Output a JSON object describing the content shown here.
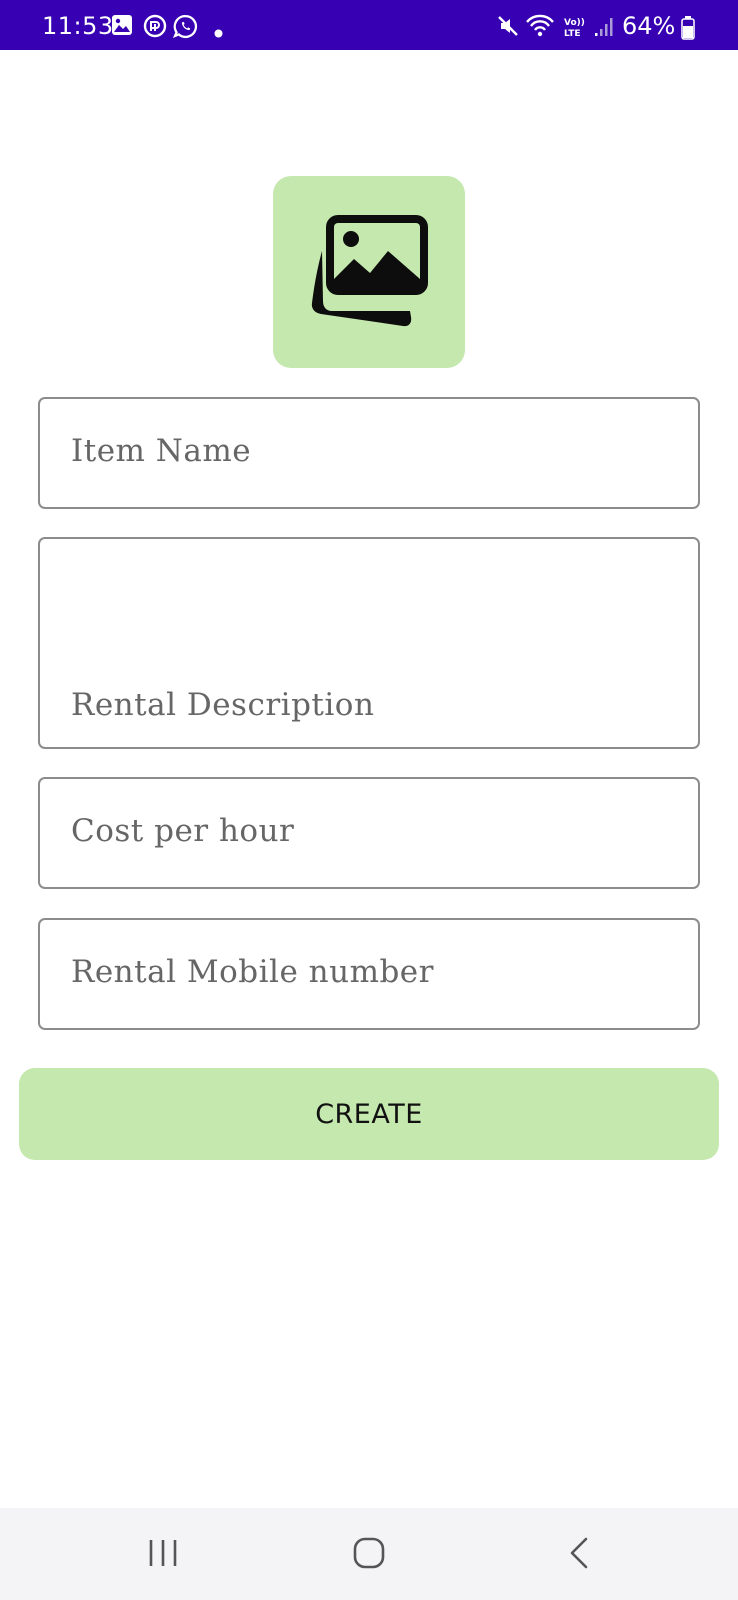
{
  "status_bar": {
    "time": "11:53",
    "battery": "64%",
    "background_color": "#3700b3",
    "icons": [
      "gallery-icon",
      "app-icon",
      "whatsapp-icon",
      "dot-icon",
      "mute-icon",
      "wifi-icon",
      "volte-icon",
      "signal-icon",
      "battery-icon"
    ]
  },
  "form": {
    "image_picker_icon": "image-gallery-icon",
    "accent_color": "#c5e8ae",
    "item_name_placeholder": "Item Name",
    "description_placeholder": "Rental Description",
    "cost_placeholder": "Cost per hour",
    "mobile_placeholder": "Rental Mobile number",
    "create_label": "CREATE"
  },
  "nav_bar": {
    "icons": [
      "recent-apps-icon",
      "home-icon",
      "back-icon"
    ]
  }
}
